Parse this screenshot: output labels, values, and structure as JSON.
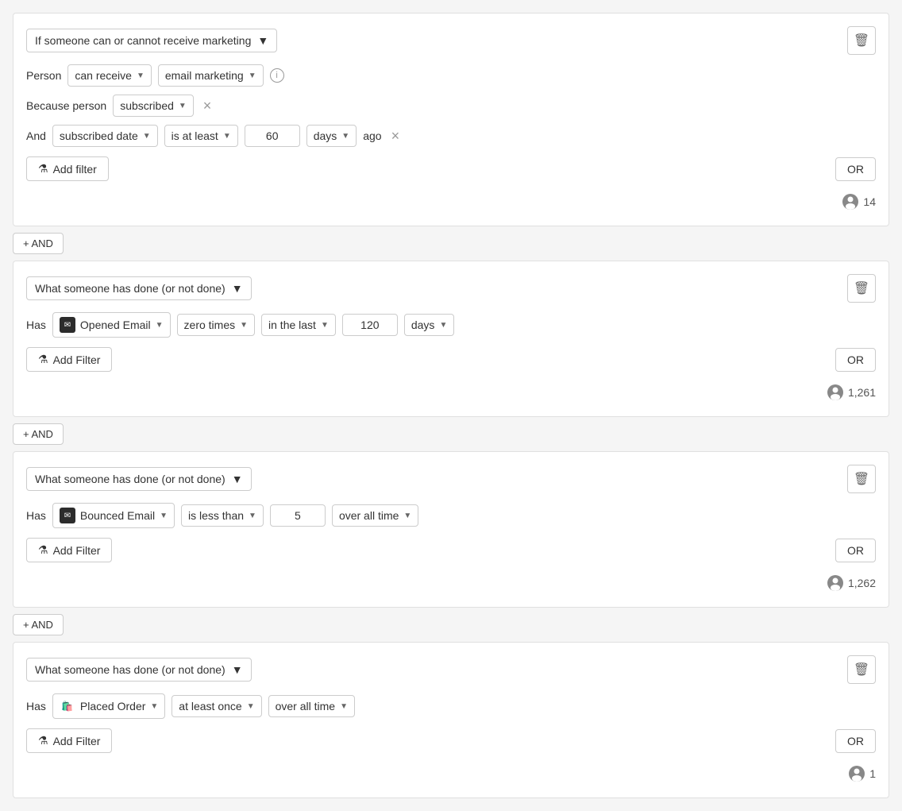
{
  "blocks": [
    {
      "id": "block1",
      "type_label": "If someone can or cannot receive marketing",
      "person_label": "Person",
      "person_condition": "can receive",
      "person_type": "email marketing",
      "because_label": "Because person",
      "because_value": "subscribed",
      "and_label": "And",
      "date_field": "subscribed date",
      "operator": "is at least",
      "value": "60",
      "unit": "days",
      "suffix": "ago",
      "add_filter_label": "Add filter",
      "or_label": "OR",
      "count": "14"
    },
    {
      "id": "block2",
      "type_label": "What someone has done (or not done)",
      "has_label": "Has",
      "event_icon_type": "email-dark",
      "event": "Opened Email",
      "frequency_operator": "zero times",
      "time_operator": "in the last",
      "time_value": "120",
      "time_unit": "days",
      "add_filter_label": "Add Filter",
      "or_label": "OR",
      "count": "1,261"
    },
    {
      "id": "block3",
      "type_label": "What someone has done (or not done)",
      "has_label": "Has",
      "event_icon_type": "email-dark",
      "event": "Bounced Email",
      "frequency_operator": "is less than",
      "time_value_simple": "5",
      "time_operator_simple": "over all time",
      "add_filter_label": "Add Filter",
      "or_label": "OR",
      "count": "1,262"
    },
    {
      "id": "block4",
      "type_label": "What someone has done (or not done)",
      "has_label": "Has",
      "event_icon_type": "shopify",
      "event": "Placed Order",
      "frequency_operator": "at least once",
      "time_operator_simple": "over all time",
      "add_filter_label": "Add Filter",
      "or_label": "OR",
      "count": "1"
    }
  ],
  "and_button_label": "+ AND",
  "icons": {
    "delete": "🗑",
    "filter": "⚗",
    "person": "👤",
    "plus": "+",
    "info": "i",
    "email": "✉",
    "shopify": "🛍️"
  }
}
